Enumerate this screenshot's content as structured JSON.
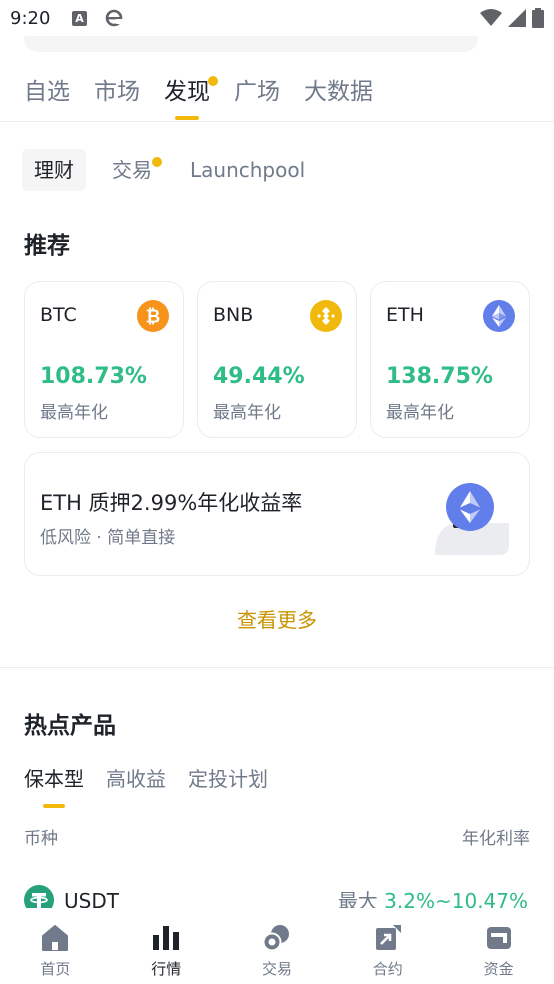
{
  "status_bar": {
    "time": "9:20",
    "app_icon_letter": "A"
  },
  "main_tabs": [
    {
      "label": "自选",
      "active": false,
      "dot": false
    },
    {
      "label": "市场",
      "active": false,
      "dot": false
    },
    {
      "label": "发现",
      "active": true,
      "dot": true
    },
    {
      "label": "广场",
      "active": false,
      "dot": false
    },
    {
      "label": "大数据",
      "active": false,
      "dot": false
    }
  ],
  "sub_tabs": [
    {
      "label": "理财",
      "active": true,
      "dot": false
    },
    {
      "label": "交易",
      "active": false,
      "dot": true
    },
    {
      "label": "Launchpool",
      "active": false,
      "dot": false
    }
  ],
  "recommend": {
    "title": "推荐",
    "cards": [
      {
        "coin": "BTC",
        "rate": "108.73%",
        "label": "最高年化",
        "icon": "bitcoin-icon",
        "color": "#f7931a"
      },
      {
        "coin": "BNB",
        "rate": "49.44%",
        "label": "最高年化",
        "icon": "bnb-icon",
        "color": "#f0b90b"
      },
      {
        "coin": "ETH",
        "rate": "138.75%",
        "label": "最高年化",
        "icon": "ethereum-icon",
        "color": "#627eea"
      }
    ]
  },
  "banner": {
    "title": "ETH 质押2.99%年化收益率",
    "subtitle": "低风险 · 简单直接"
  },
  "more_link": "查看更多",
  "hot_products": {
    "title": "热点产品",
    "tabs": [
      {
        "label": "保本型",
        "active": true
      },
      {
        "label": "高收益",
        "active": false
      },
      {
        "label": "定投计划",
        "active": false
      }
    ],
    "col_left": "币种",
    "col_right": "年化利率",
    "rows": [
      {
        "coin": "USDT",
        "rate_prefix": "最大",
        "rate": "3.2%~10.47%"
      }
    ]
  },
  "bottom_nav": [
    {
      "label": "首页",
      "icon": "home-icon",
      "active": false
    },
    {
      "label": "行情",
      "icon": "bar-chart-icon",
      "active": true
    },
    {
      "label": "交易",
      "icon": "trade-icon",
      "active": false
    },
    {
      "label": "合约",
      "icon": "futures-icon",
      "active": false
    },
    {
      "label": "资金",
      "icon": "wallet-icon",
      "active": false
    }
  ],
  "colors": {
    "accent": "#f0b90b",
    "link": "#c99400",
    "positive": "#2ebd85",
    "text_primary": "#1e2329",
    "text_secondary": "#707a8a",
    "usdt": "#26a17b"
  }
}
